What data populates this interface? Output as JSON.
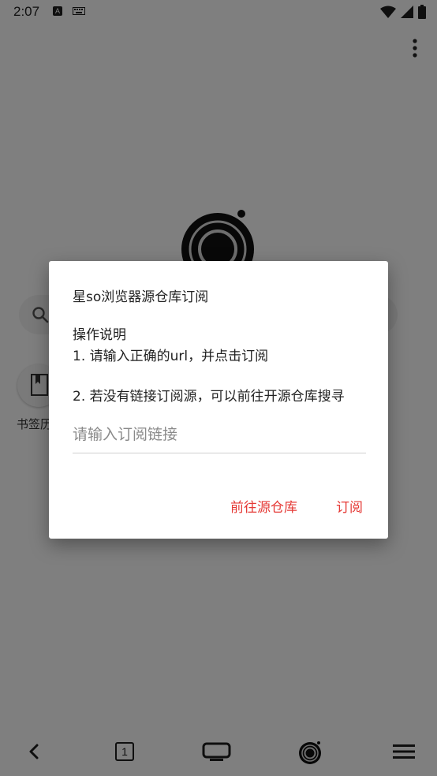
{
  "status_bar": {
    "time": "2:07",
    "a_badge": "A",
    "icons": [
      "keyboard-icon",
      "wifi-icon",
      "signal-icon",
      "battery-icon"
    ]
  },
  "home": {
    "bookmark_label": "书签历"
  },
  "bottom_nav": {
    "tab_count": "1",
    "icons": [
      "back-icon",
      "tabs-icon",
      "tv-icon",
      "home-logo-icon",
      "menu-icon"
    ]
  },
  "dialog": {
    "title": "星so浏览器源仓库订阅",
    "message_heading": "操作说明",
    "message_line1": "1. 请输入正确的url，并点击订阅",
    "message_line2": "2. 若没有链接订阅源，可以前往开源仓库搜寻",
    "input_placeholder": "请输入订阅链接",
    "input_value": "",
    "button_goto": "前往源仓库",
    "button_subscribe": "订阅",
    "accent_color": "#e53935"
  }
}
